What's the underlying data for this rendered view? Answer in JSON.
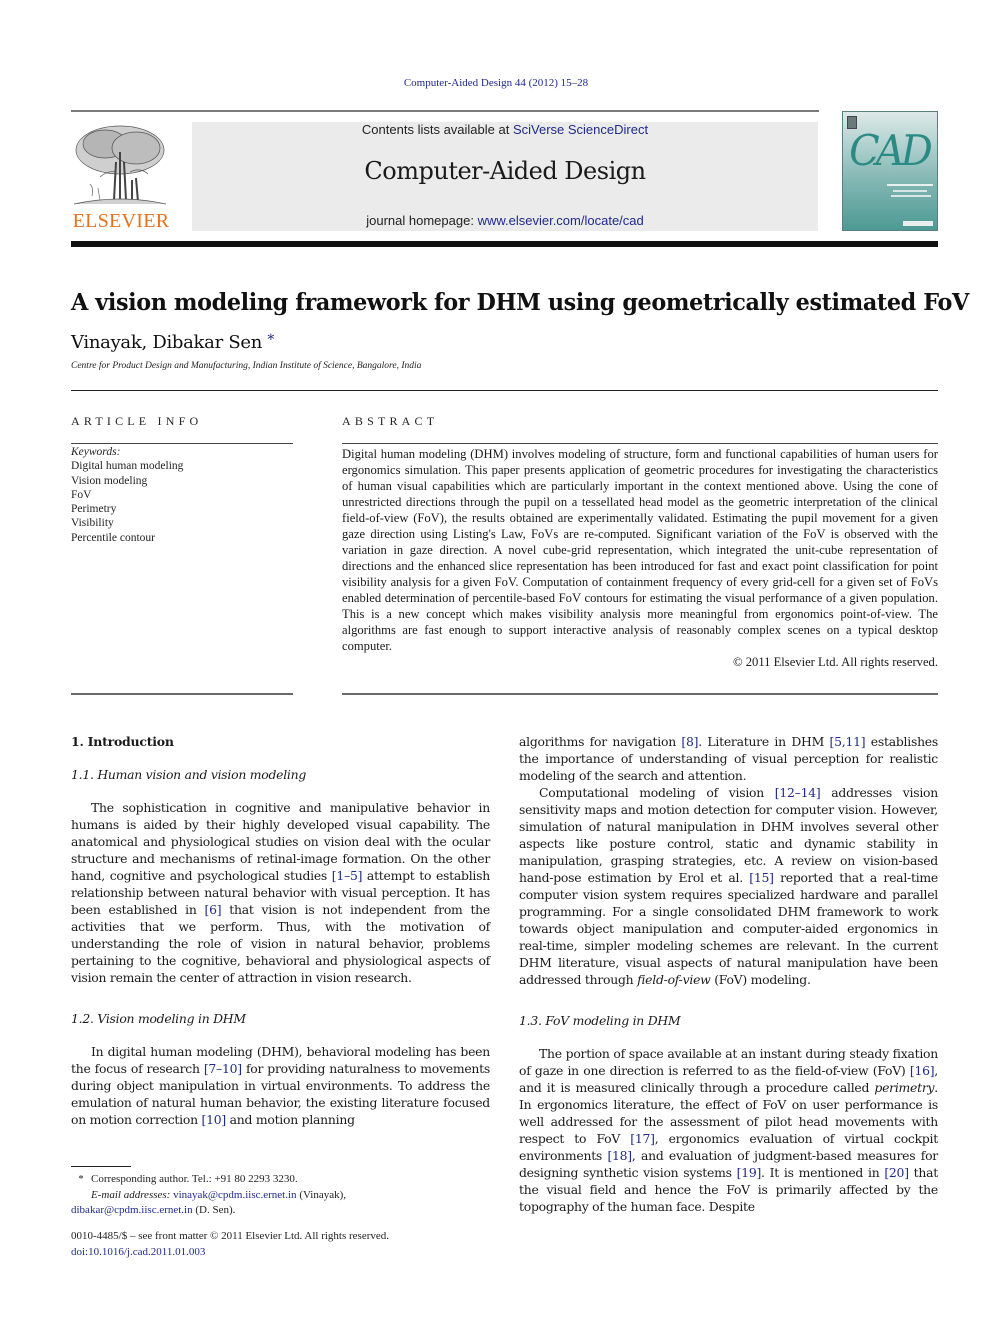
{
  "running_head": "Computer-Aided Design 44 (2012) 15–28",
  "publisher": {
    "logo_icon": "elsevier-tree-logo",
    "wordmark": "ELSEVIER",
    "wordmark_color": "#e8711c"
  },
  "masthead": {
    "contents_prefix": "Contents lists available at ",
    "contents_link": "SciVerse ScienceDirect",
    "journal_name": "Computer-Aided Design",
    "homepage_prefix": "journal homepage: ",
    "homepage_link": "www.elsevier.com/locate/cad"
  },
  "cover": {
    "icon": "journal-cover-image",
    "logo_text": "CAD"
  },
  "article": {
    "title": "A vision modeling framework for DHM using geometrically estimated FoV",
    "authors": "Vinayak, Dibakar Sen",
    "corresponding_mark": "*",
    "affiliation": "Centre for Product Design and Manufacturing, Indian Institute of Science, Bangalore, India"
  },
  "article_info": {
    "heading": "ARTICLE INFO",
    "keywords_label": "Keywords:",
    "keywords": [
      "Digital human modeling",
      "Vision modeling",
      "FoV",
      "Perimetry",
      "Visibility",
      "Percentile contour"
    ]
  },
  "abstract": {
    "heading": "ABSTRACT",
    "text": "Digital human modeling (DHM) involves modeling of structure, form and functional capabilities of human users for ergonomics simulation. This paper presents application of geometric procedures for investigating the characteristics of human visual capabilities which are particularly important in the context mentioned above. Using the cone of unrestricted directions through the pupil on a tessellated head model as the geometric interpretation of the clinical field-of-view (FoV), the results obtained are experimentally validated. Estimating the pupil movement for a given gaze direction using Listing's Law, FoVs are re-computed. Significant variation of the FoV is observed with the variation in gaze direction. A novel cube-grid representation, which integrated the unit-cube representation of directions and the enhanced slice representation has been introduced for fast and exact point classification for point visibility analysis for a given FoV. Computation of containment frequency of every grid-cell for a given set of FoVs enabled determination of percentile-based FoV contours for estimating the visual performance of a given population. This is a new concept which makes visibility analysis more meaningful from ergonomics point-of-view. The algorithms are fast enough to support interactive analysis of reasonably complex scenes on a typical desktop computer.",
    "copyright": "© 2011 Elsevier Ltd. All rights reserved."
  },
  "body": {
    "section1_heading": "1.  Introduction",
    "sub1_1_heading": "1.1.  Human vision and vision modeling",
    "p1": {
      "t1": "The sophistication in cognitive and manipulative behavior in humans is aided by their highly developed visual capability. The anatomical and physiological studies on vision deal with the ocular structure and mechanisms of retinal-image formation. On the other hand, cognitive and psychological studies ",
      "r1": "[1–5]",
      "t2": " attempt to establish relationship between natural behavior with visual perception. It has been established in ",
      "r2": "[6]",
      "t3": " that vision is not independent from the activities that we perform. Thus, with the motivation of understanding the role of vision in natural behavior, problems pertaining to the cognitive, behavioral and physiological aspects of vision remain the center of attraction in vision research."
    },
    "sub1_2_heading": "1.2.  Vision modeling in DHM",
    "p2": {
      "t1": "In digital human modeling (DHM), behavioral modeling has been the focus of research ",
      "r1": "[7–10]",
      "t2": " for providing naturalness to movements during object manipulation in virtual environments. To address the emulation of natural human behavior, the existing literature focused on motion correction ",
      "r2": "[10]",
      "t3": " and motion planning"
    },
    "p2_cont": {
      "t1": "algorithms for navigation ",
      "r1": "[8]",
      "t2": ". Literature in DHM ",
      "r2": "[5,11]",
      "t3": " establishes the importance of understanding of visual perception for realistic modeling of the search and attention."
    },
    "p3": {
      "t1": "Computational modeling of vision ",
      "r1": "[12–14]",
      "t2": " addresses vision sensitivity maps and motion detection for computer vision. However, simulation of natural manipulation in DHM involves several other aspects like posture control, static and dynamic stability in manipulation, grasping strategies, etc. A review on vision-based hand-pose estimation by Erol et al. ",
      "r2": "[15]",
      "t3": " reported that a real-time computer vision system requires specialized hardware and parallel programming. For a single consolidated DHM framework to work towards object manipulation and computer-aided ergonomics in real-time, simpler modeling schemes are relevant. In the current DHM literature, visual aspects of natural manipulation have been addressed through ",
      "em": "field-of-view",
      "t4": " (FoV) modeling."
    },
    "sub1_3_heading": "1.3.  FoV modeling in DHM",
    "p4": {
      "t1": "The portion of space available at an instant during steady fixation of gaze in one direction is referred to as the field-of-view (FoV) ",
      "r1": "[16]",
      "t2": ", and it is measured clinically through a procedure called ",
      "em": "perimetry",
      "t3": ". In ergonomics literature, the effect of FoV on user performance is well addressed for the assessment of pilot head movements with respect to FoV ",
      "r2": "[17]",
      "t4": ", ergonomics evaluation of virtual cockpit environments ",
      "r3": "[18]",
      "t5": ", and evaluation of judgment-based measures for designing synthetic vision systems ",
      "r4": "[19]",
      "t6": ". It is mentioned in ",
      "r5": "[20]",
      "t7": " that the visual field and hence the FoV is primarily affected by the topography of the human face. Despite"
    }
  },
  "footnote": {
    "mark": "*",
    "corresponding": "Corresponding author. Tel.: +91 80 2293 3230.",
    "email_label": "E-mail addresses:",
    "email1": "vinayak@cpdm.iisc.ernet.in",
    "email1_name": " (Vinayak),",
    "email2": "dibakar@cpdm.iisc.ernet.in",
    "email2_name": " (D. Sen)."
  },
  "front_matter": {
    "issn_line": "0010-4485/$ – see front matter © 2011 Elsevier Ltd. All rights reserved.",
    "doi": "doi:10.1016/j.cad.2011.01.003"
  },
  "colors": {
    "link": "#1f2a8c",
    "masthead_bg": "#ebebeb",
    "cover_teal": "#2b8a84"
  }
}
